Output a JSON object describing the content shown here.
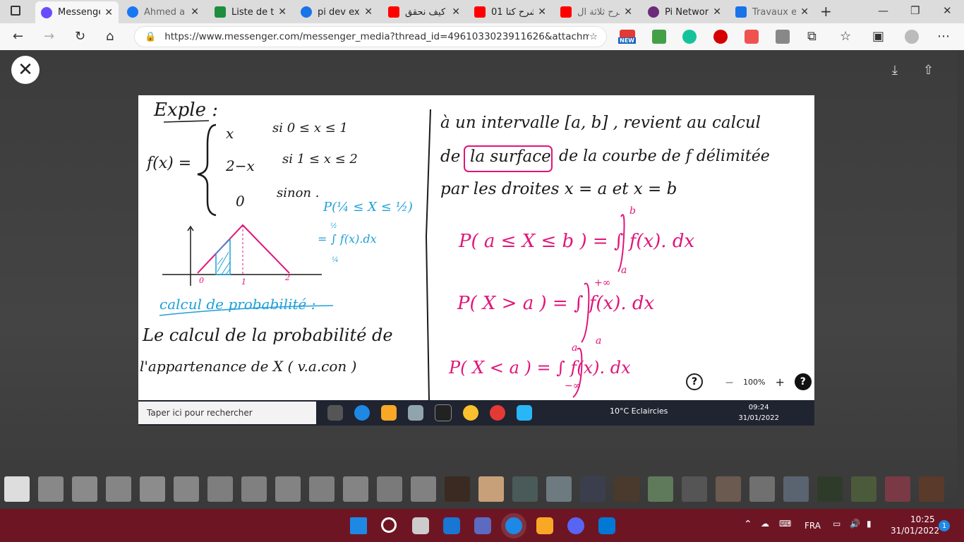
{
  "browser": {
    "tabs": [
      {
        "title": "Messenger",
        "color": "#6a4cff"
      },
      {
        "title": "Ahmed a é",
        "color": "#1877f2"
      },
      {
        "title": "Liste de tâ",
        "color": "#1e8e3e"
      },
      {
        "title": "pi dev exer",
        "color": "#1a73e8"
      },
      {
        "title": "كيف نحقق",
        "color": "#ff0000"
      },
      {
        "title": "01 شرح كتا",
        "color": "#ff0000"
      },
      {
        "title": "شرح ثلاثة ال",
        "color": "#ff0000"
      },
      {
        "title": "Pi Network",
        "color": "#6b2b7a"
      },
      {
        "title": "Travaux et",
        "color": "#1a73e8"
      }
    ],
    "url": "https://www.messenger.com/messenger_media?thread_id=4961033023911626&attachment_...",
    "new_badge": "NEW"
  },
  "photo": {
    "left": {
      "expl": "Exple :",
      "fx": "f(x) =",
      "case1_expr": "x",
      "case1_cond": "si  0 ≤ x ≤ 1",
      "case2_expr": "2−x",
      "case2_cond": "si  1 ≤ x ≤ 2",
      "case3_expr": "0",
      "case3_cond": "sinon .",
      "prob": "P(¼ ≤ X ≤ ½)",
      "integral": "= ∫ f(x).dx",
      "int_lower": "¼",
      "int_upper": "½",
      "axis_0": "0",
      "axis_1": "1",
      "axis_2": "2",
      "calc_title": "calcul de probabilité :",
      "line1": "Le calcul de la probabilité de",
      "line2": "l'appartenance de X ( v.a.con )"
    },
    "right": {
      "line1": "à un intervalle [a, b] , revient au calcul",
      "line2_a": "de",
      "line2_box": "la surface",
      "line2_b": "de la courbe de f délimitée",
      "line3": "par les droites  x = a  et x = b",
      "eq1": "P( a ≤ X ≤ b )  = ∫ f(x). dx",
      "eq1_up": "b",
      "eq1_lo": "a",
      "eq2": "P( X > a )  = ∫ f(x). dx",
      "eq2_up": "+∞",
      "eq2_lo": "a",
      "eq3": "P( X < a )  = ∫ f(x). dx",
      "eq3_up": "a",
      "eq3_lo": "−∞"
    },
    "zoom": "100%",
    "inner_taskbar": {
      "search": "Taper ici pour rechercher",
      "weather": "10°C  Eclaircies",
      "time": "09:24",
      "date": "31/01/2022"
    }
  },
  "taskbar": {
    "lang": "FRA",
    "time": "10:25",
    "date": "31/01/2022",
    "notif": "1"
  }
}
